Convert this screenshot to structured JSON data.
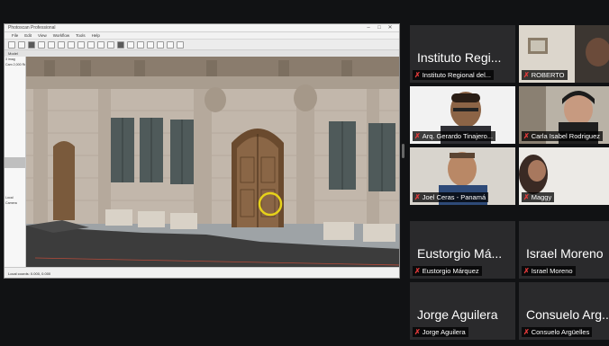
{
  "shared_app": {
    "title": "Photoscan Professional",
    "menu": [
      "File",
      "Edit",
      "View",
      "Workflow",
      "Tools",
      "Help"
    ],
    "tabs": [
      "Model"
    ],
    "side_lines": [
      "3 imag",
      "Cam 2,000 Re",
      "Local",
      "Camera"
    ],
    "viewport_caption": "Local coords: 0.000, 0.000"
  },
  "participants": [
    {
      "name": "Instituto Regional del...",
      "big_name": "Instituto Regi...",
      "video": false
    },
    {
      "name": "ROBERTO",
      "big_name": "",
      "video": true
    },
    {
      "name": "Arq. Gerardo Tinajero...",
      "big_name": "",
      "video": true
    },
    {
      "name": "Carla Isabel Rodriguez",
      "big_name": "",
      "video": true
    },
    {
      "name": "Joel Ceras - Panamá",
      "big_name": "",
      "video": true
    },
    {
      "name": "Maggy",
      "big_name": "",
      "video": true
    },
    {
      "name": "Eustorgio Márquez",
      "big_name": "Eustorgio Má...",
      "video": false
    },
    {
      "name": "Israel Moreno",
      "big_name": "Israel Moreno",
      "video": false
    },
    {
      "name": "Jorge Aguilera",
      "big_name": "Jorge Aguilera",
      "video": false
    },
    {
      "name": "Consuelo Argüelles",
      "big_name": "Consuelo Arg...",
      "video": false
    }
  ],
  "colors": {
    "background": "#111214",
    "tile": "#2a2a2c",
    "muted_mic": "#e23a3a",
    "highlight_circle": "#e6d21a"
  },
  "icons": {
    "muted": "microphone-muted-icon"
  }
}
